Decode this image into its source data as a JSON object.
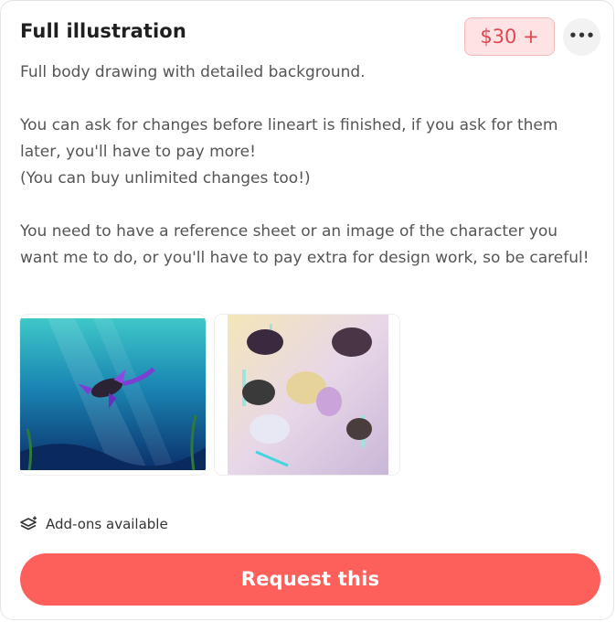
{
  "listing": {
    "title": "Full illustration",
    "price": "$30 +",
    "description": {
      "p1": "Full body drawing with detailed background.",
      "p2a": "You can ask for changes before lineart is finished, if you ask for them later, you'll have to pay more!",
      "p2b": "(You can buy unlimited changes too!)",
      "p3": "You need to have a reference sheet or an image of the character you want me to do, or you'll have to pay extra for design work, so be careful!"
    },
    "images": [
      {
        "name": "underwater-illustration",
        "caption": ""
      },
      {
        "name": "group-illustration",
        "caption": ""
      }
    ],
    "addons_label": "Add-ons available",
    "request_label": "Request this"
  },
  "icons": {
    "more": "ellipsis-icon",
    "addons": "layers-plus-icon"
  },
  "colors": {
    "accent": "#fd5f5b",
    "price_text": "#e0474f",
    "price_bg": "#fde3e3"
  }
}
